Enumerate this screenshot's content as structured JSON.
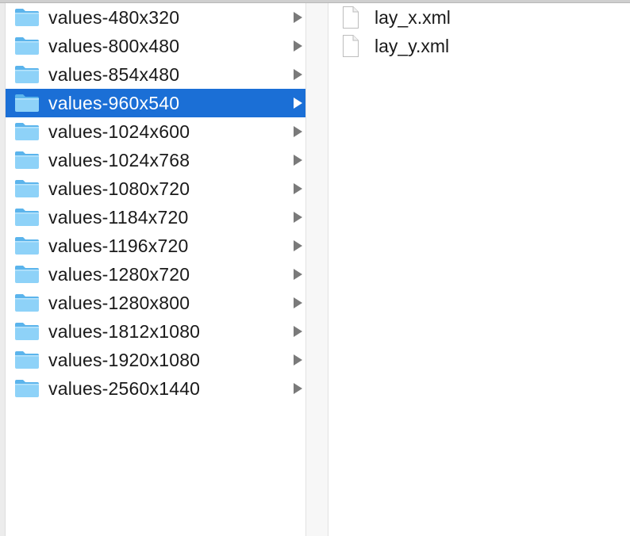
{
  "window": {
    "view": "column-view"
  },
  "colors": {
    "selection": "#1b6fd6",
    "folder_light": "#8ed2f8",
    "folder_dark": "#5bb4ec",
    "chevron": "#7a7a7a"
  },
  "folders": [
    {
      "label": "values-480x320",
      "icon": "folder-icon",
      "selected": false
    },
    {
      "label": "values-800x480",
      "icon": "folder-icon",
      "selected": false
    },
    {
      "label": "values-854x480",
      "icon": "folder-icon",
      "selected": false
    },
    {
      "label": "values-960x540",
      "icon": "folder-icon",
      "selected": true
    },
    {
      "label": "values-1024x600",
      "icon": "folder-icon",
      "selected": false
    },
    {
      "label": "values-1024x768",
      "icon": "folder-icon",
      "selected": false
    },
    {
      "label": "values-1080x720",
      "icon": "folder-icon",
      "selected": false
    },
    {
      "label": "values-1184x720",
      "icon": "folder-icon",
      "selected": false
    },
    {
      "label": "values-1196x720",
      "icon": "folder-icon",
      "selected": false
    },
    {
      "label": "values-1280x720",
      "icon": "folder-icon",
      "selected": false
    },
    {
      "label": "values-1280x800",
      "icon": "folder-icon",
      "selected": false
    },
    {
      "label": "values-1812x1080",
      "icon": "folder-icon",
      "selected": false
    },
    {
      "label": "values-1920x1080",
      "icon": "folder-icon",
      "selected": false
    },
    {
      "label": "values-2560x1440",
      "icon": "folder-icon",
      "selected": false
    }
  ],
  "files": [
    {
      "label": "lay_x.xml",
      "icon": "document-icon"
    },
    {
      "label": "lay_y.xml",
      "icon": "document-icon"
    }
  ]
}
